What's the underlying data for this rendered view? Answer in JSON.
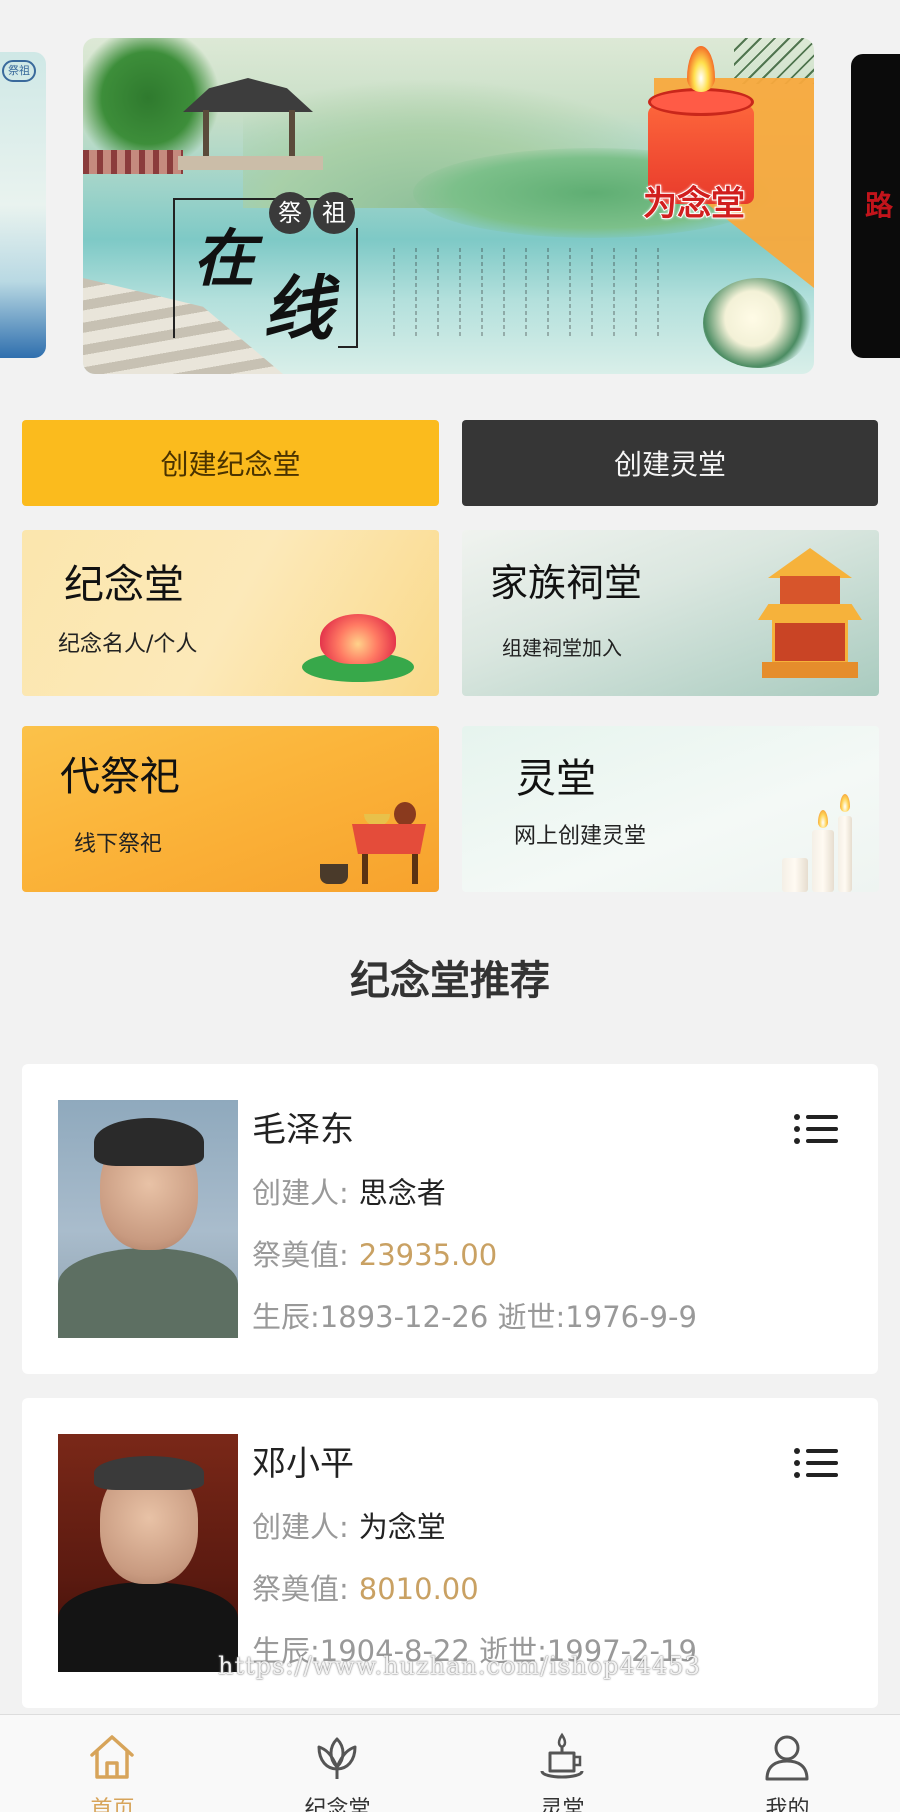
{
  "banner": {
    "seal_chars": [
      "祭",
      "祖"
    ],
    "calligraphy": [
      "在",
      "线"
    ],
    "brand_logo": "为念堂",
    "left_slide_tag": "祭祖",
    "right_slide_text": "路"
  },
  "actions": {
    "create_memorial_label": "创建纪念堂",
    "create_spirit_hall_label": "创建灵堂",
    "create_memorial_color": "#fbbb1d",
    "create_spirit_hall_color": "#363636"
  },
  "features": [
    {
      "title": "纪念堂",
      "subtitle": "纪念名人/个人"
    },
    {
      "title": "家族祠堂",
      "subtitle": "组建祠堂加入"
    },
    {
      "title": "代祭祀",
      "subtitle": "线下祭祀"
    },
    {
      "title": "灵堂",
      "subtitle": "网上创建灵堂"
    }
  ],
  "recommend": {
    "section_title": "纪念堂推荐",
    "creator_label": "创建人:",
    "offering_label": "祭奠值:",
    "items": [
      {
        "name": "毛泽东",
        "creator": "思念者",
        "offering": "23935.00",
        "dates": "生辰:1893-12-26 逝世:1976-9-9"
      },
      {
        "name": "邓小平",
        "creator": "为念堂",
        "offering": "8010.00",
        "dates": "生辰:1904-8-22 逝世:1997-2-19"
      }
    ]
  },
  "watermark": "https://www.huzhan.com/ishop44453",
  "tabbar": {
    "active_color": "#d7a45a",
    "tabs": [
      {
        "label": "首页",
        "icon": "home-icon"
      },
      {
        "label": "纪念堂",
        "icon": "lotus-icon"
      },
      {
        "label": "灵堂",
        "icon": "candle-icon"
      },
      {
        "label": "我的",
        "icon": "user-icon"
      }
    ]
  }
}
